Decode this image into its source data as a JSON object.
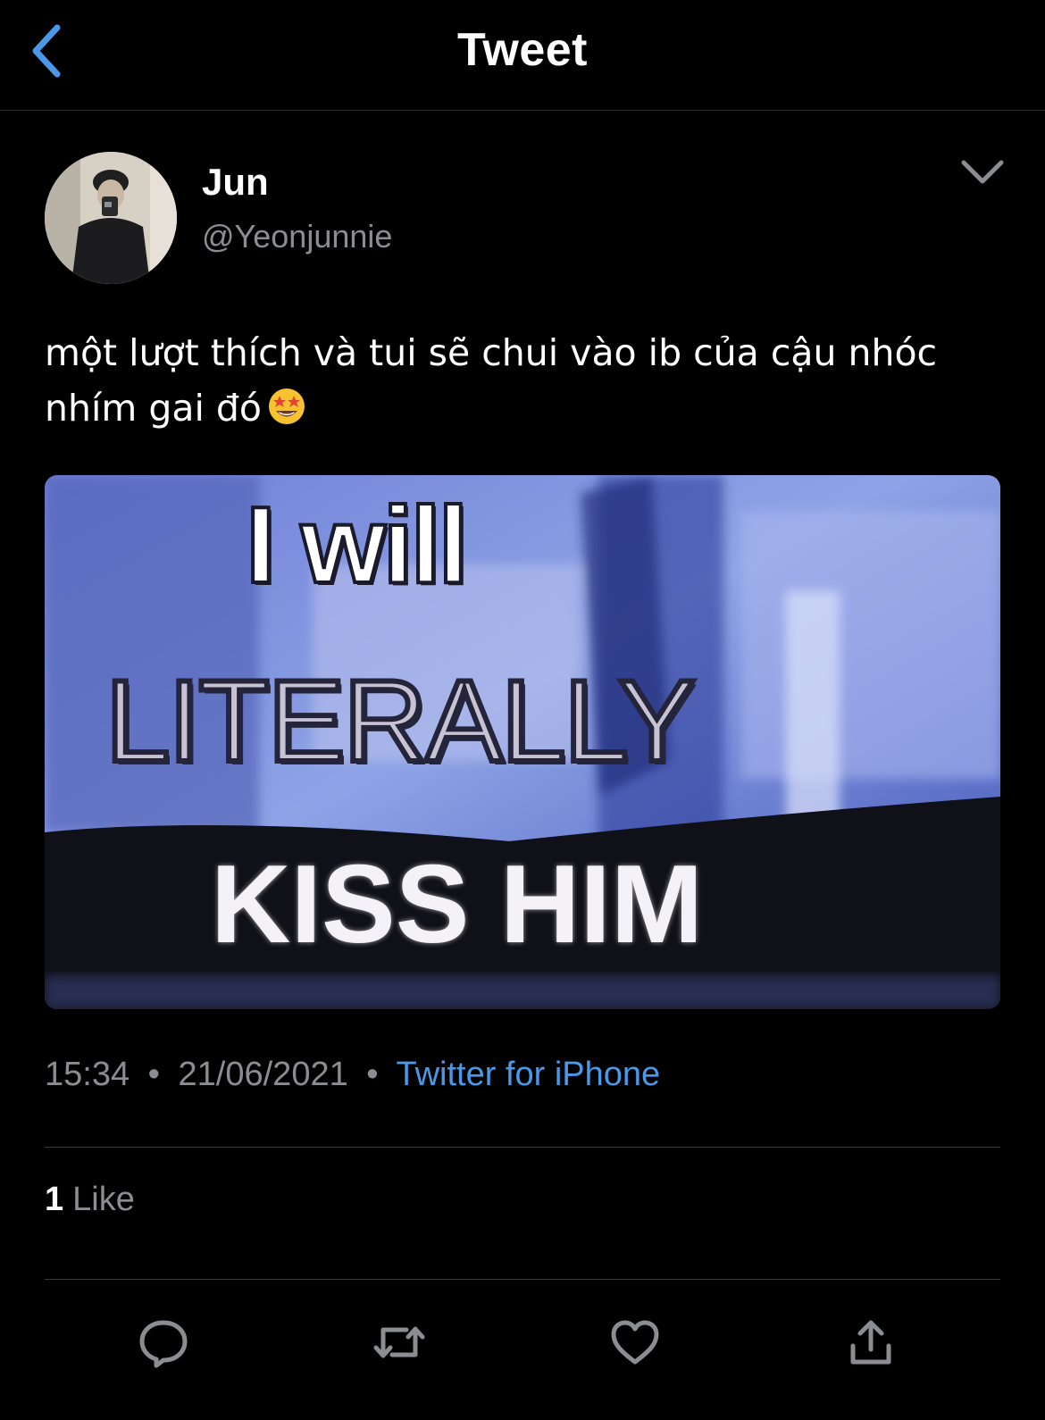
{
  "colors": {
    "background": "#000000",
    "accent": "#4a99e9",
    "secondary_text": "#8a8d91",
    "divider": "#3a3a3c"
  },
  "header": {
    "title": "Tweet",
    "back_icon": "chevron-left-icon"
  },
  "tweet": {
    "author": {
      "name": "Jun",
      "handle": "@Yeonjunnie"
    },
    "text": "một lượt thích và tui sẽ chui vào ib của cậu nhóc nhím gai đó",
    "emoji": "star-struck-emoji",
    "media": {
      "line1": "I will",
      "line2": "LITERALLY",
      "line3": "KISS HIM"
    },
    "time": "15:34",
    "date": "21/06/2021",
    "separator": "•",
    "source": "Twitter for iPhone",
    "likes": {
      "count": "1",
      "label": "Like"
    }
  },
  "actions": [
    {
      "name": "reply",
      "icon": "reply-icon"
    },
    {
      "name": "retweet",
      "icon": "retweet-icon"
    },
    {
      "name": "like",
      "icon": "heart-icon"
    },
    {
      "name": "share",
      "icon": "share-icon"
    }
  ]
}
